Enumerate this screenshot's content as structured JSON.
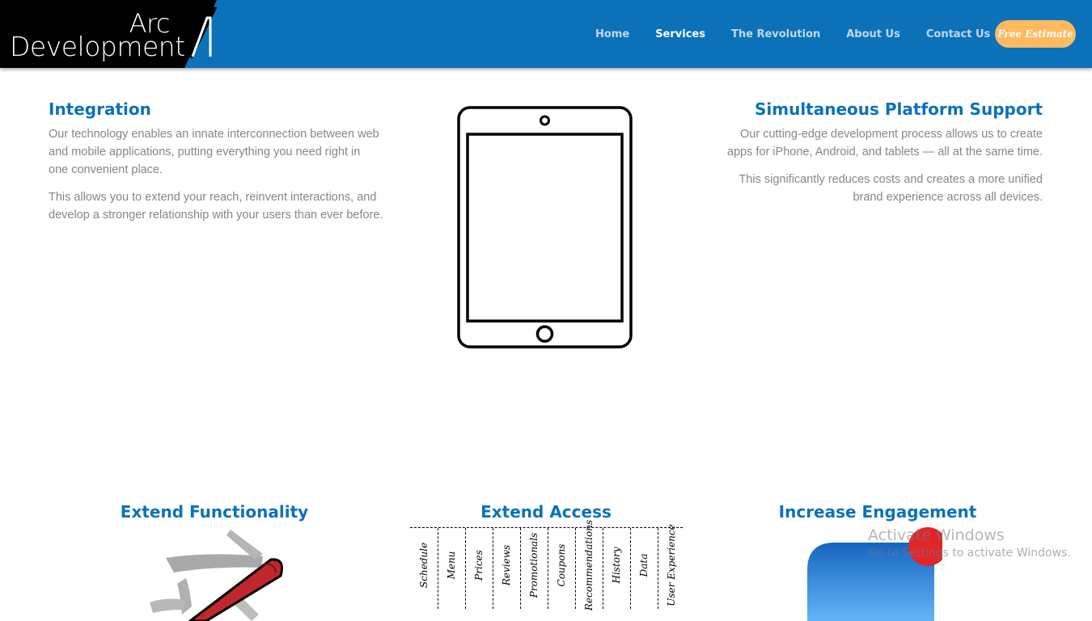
{
  "header": {
    "logo": {
      "line1": "Arc",
      "line2": "Development"
    },
    "tabs": [
      {
        "label": "Home",
        "active": false
      },
      {
        "label": "Services",
        "active": true
      },
      {
        "label": "The Revolution",
        "active": false
      },
      {
        "label": "About Us",
        "active": false
      },
      {
        "label": "Contact Us",
        "active": false
      }
    ],
    "estimate_label": "Free Estimate"
  },
  "integration": {
    "title": "Integration",
    "paragraphs": [
      "Our technology enables an innate interconnection between web and mobile applications, putting everything you need right in one convenient place.",
      "This allows you to extend your reach, reinvent interactions, and develop a stronger relationship with your users than ever before."
    ]
  },
  "simultaneous": {
    "title": "Simultaneous Platform Support",
    "paragraphs": [
      "Our cutting-edge development process allows us to create apps for iPhone, Android, and tablets — all at the same time.",
      "This significantly reduces costs and creates a more unified brand experience across all devices."
    ]
  },
  "features": {
    "functionality": {
      "title": "Extend Functionality"
    },
    "access": {
      "title": "Extend Access",
      "columns": [
        "Schedule",
        "Menu",
        "Prices",
        "Reviews",
        "Promotionals",
        "Coupons",
        "Recommendations",
        "History",
        "Data",
        "User Experience"
      ]
    },
    "engagement": {
      "title": "Increase Engagement"
    }
  },
  "watermark": {
    "title": "Activate Windows",
    "subtitle": "Go to Settings to activate Windows."
  },
  "colors": {
    "blue": "#0b72b9",
    "orange": "#ffba60",
    "text_grey": "#868686"
  }
}
